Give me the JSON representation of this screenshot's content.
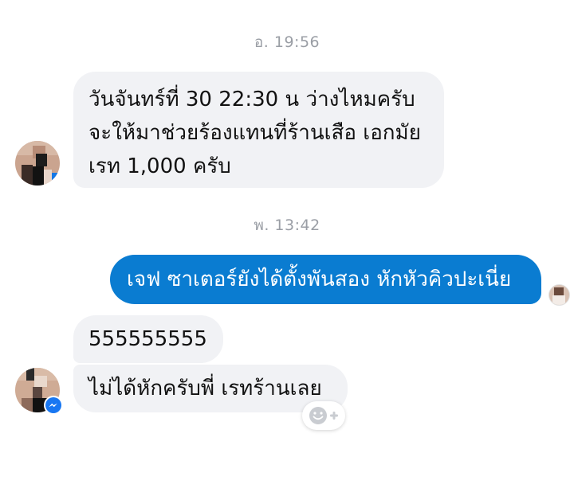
{
  "conversation": {
    "timestamps": [
      {
        "text": "อ. 19:56"
      },
      {
        "text": "พ. 13:42"
      }
    ],
    "messages": [
      {
        "direction": "incoming",
        "lines": [
          "วันจันทร์ที่ 30 22:30 น ว่างไหมครับ",
          "จะให้มาช่วยร้องแทนที่ร้านเสือ เอกมัย",
          "เรท 1,000 ครับ"
        ]
      },
      {
        "direction": "outgoing",
        "text": "เจฟ ซาเตอร์ยังได้ตั้งพันสอง หักหัวคิวปะเนี่ย"
      },
      {
        "direction": "incoming",
        "text": "555555555"
      },
      {
        "direction": "incoming",
        "text": "ไม่ได้หักครับพี่ เรทร้านเลย"
      }
    ]
  },
  "icons": {
    "reaction": "add-reaction-icon",
    "messenger_badge": "messenger-badge-icon"
  },
  "colors": {
    "outgoing_bubble": "#0a7cd1",
    "incoming_bubble": "#f1f2f5",
    "timestamp": "#9a9ea5",
    "messenger_badge": "#1877f2"
  }
}
